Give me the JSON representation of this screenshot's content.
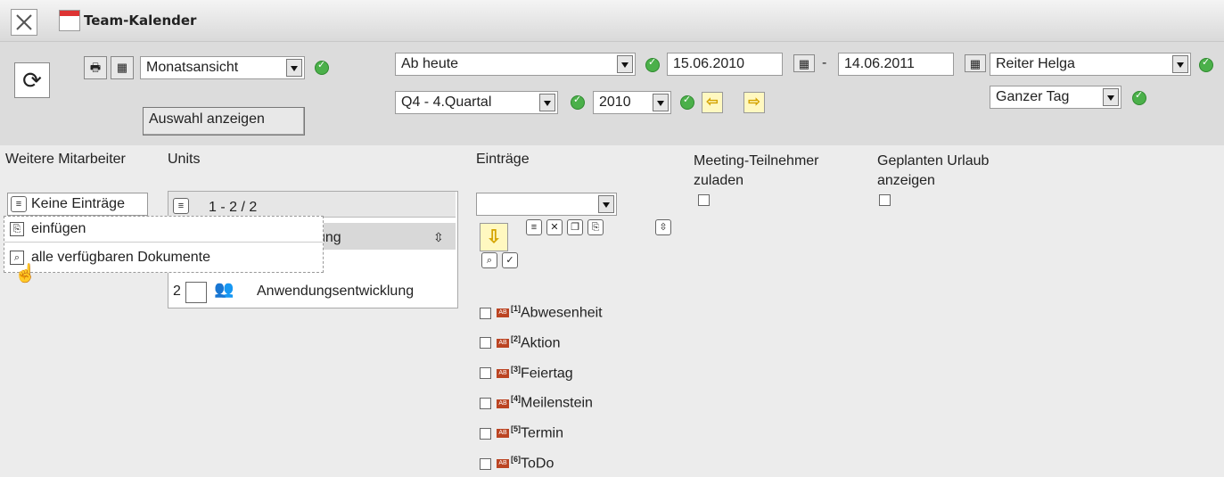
{
  "window": {
    "title": "Team-Kalender"
  },
  "toolbar": {
    "view_select": "Monatsansicht",
    "show_selection_button": "Auswahl anzeigen",
    "range_select": "Ab heute",
    "date_from": "15.06.2010",
    "date_separator": "-",
    "date_to": "14.06.2011",
    "person_select": "Reiter Helga",
    "quarter_select": "Q4 - 4.Quartal",
    "year_select": "2010",
    "day_select": "Ganzer Tag"
  },
  "sections": {
    "further_employees": "Weitere Mitarbeiter",
    "units": "Units",
    "entries": "Einträge",
    "meeting_participants": "Meeting-Teilnehmer zuladen",
    "planned_vacation": "Geplanten Urlaub anzeigen"
  },
  "further_employees_button": "Keine Einträge",
  "context_menu": {
    "items": [
      {
        "label": "einfügen",
        "icon": "paste-icon"
      },
      {
        "label": "alle verfügbaren Dokumente",
        "icon": "search-icon"
      }
    ]
  },
  "units_panel": {
    "pager": "1 - 2 / 2",
    "header_partial": "ung",
    "rows": [
      {
        "num": "2",
        "label": "Anwendungsentwicklung"
      }
    ]
  },
  "entries_list": [
    {
      "num": "[1]",
      "label": "Abwesenheit"
    },
    {
      "num": "[2]",
      "label": "Aktion"
    },
    {
      "num": "[3]",
      "label": "Feiertag"
    },
    {
      "num": "[4]",
      "label": "Meilenstein"
    },
    {
      "num": "[5]",
      "label": "Termin"
    },
    {
      "num": "[6]",
      "label": "ToDo"
    }
  ],
  "colors": {
    "ok": "#4bb04a",
    "toolbar_bg": "#dcdcdc",
    "panel_bg": "#ececec"
  }
}
